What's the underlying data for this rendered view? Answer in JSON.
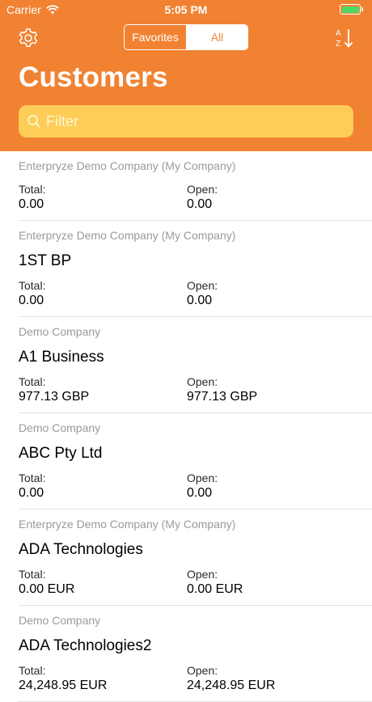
{
  "status_bar": {
    "carrier": "Carrier",
    "time": "5:05 PM",
    "battery_color": "#4cd964"
  },
  "nav": {
    "segments": [
      "Favorites",
      "All"
    ],
    "selected": "All",
    "settings_icon": "gear-icon",
    "sort_icon": "sort-az-icon"
  },
  "page": {
    "title": "Customers"
  },
  "filter": {
    "placeholder": "Filter"
  },
  "labels": {
    "total": "Total:",
    "open": "Open:"
  },
  "customers": [
    {
      "company": "Enterpryze Demo Company (My Company)",
      "name": "",
      "total": "0.00",
      "open": "0.00"
    },
    {
      "company": "Enterpryze Demo Company (My Company)",
      "name": "1ST BP",
      "total": "0.00",
      "open": "0.00"
    },
    {
      "company": "Demo Company",
      "name": "A1 Business",
      "total": "977.13 GBP",
      "open": "977.13 GBP"
    },
    {
      "company": "Demo Company",
      "name": "ABC Pty Ltd",
      "total": "0.00",
      "open": "0.00"
    },
    {
      "company": "Enterpryze Demo Company (My Company)",
      "name": "ADA Technologies",
      "total": "0.00 EUR",
      "open": "0.00 EUR"
    },
    {
      "company": "Demo Company",
      "name": "ADA Technologies2",
      "total": "24,248.95 EUR",
      "open": "24,248.95 EUR"
    }
  ],
  "colors": {
    "header": "#f08232",
    "filter_bg": "#fdcd57"
  }
}
